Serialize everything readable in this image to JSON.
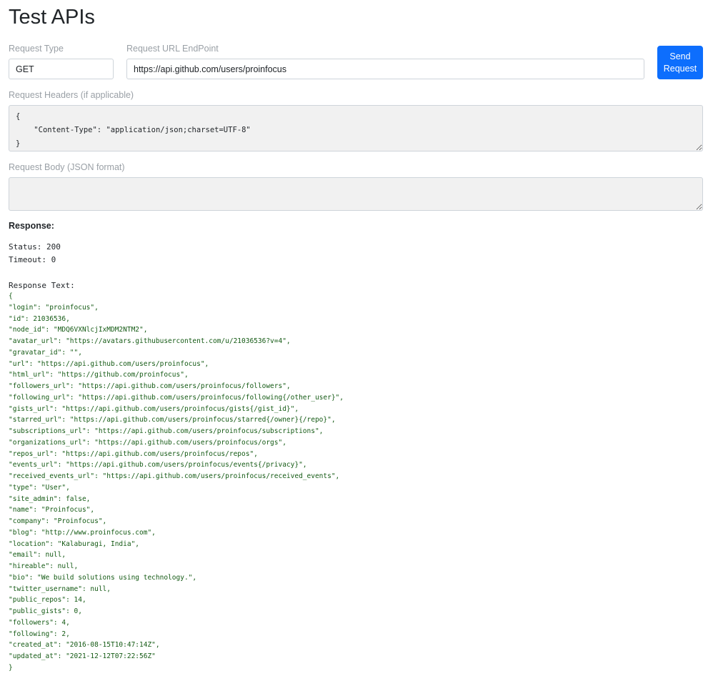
{
  "page": {
    "title": "Test APIs"
  },
  "form": {
    "request_type_label": "Request Type",
    "request_type_value": "GET",
    "url_label": "Request URL EndPoint",
    "url_value": "https://api.github.com/users/proinfocus",
    "send_button_label": "Send Request",
    "headers_label": "Request Headers (if applicable)",
    "headers_value": "{\n    \"Content-Type\": \"application/json;charset=UTF-8\"\n}",
    "body_label": "Request Body (JSON format)",
    "body_value": ""
  },
  "response": {
    "heading": "Response:",
    "status_line": "Status: 200",
    "timeout_line": "Timeout: 0",
    "text_label": "Response Text:",
    "json_text": "{\n\"login\": \"proinfocus\",\n\"id\": 21036536,\n\"node_id\": \"MDQ6VXNlcjIxMDM2NTM2\",\n\"avatar_url\": \"https://avatars.githubusercontent.com/u/21036536?v=4\",\n\"gravatar_id\": \"\",\n\"url\": \"https://api.github.com/users/proinfocus\",\n\"html_url\": \"https://github.com/proinfocus\",\n\"followers_url\": \"https://api.github.com/users/proinfocus/followers\",\n\"following_url\": \"https://api.github.com/users/proinfocus/following{/other_user}\",\n\"gists_url\": \"https://api.github.com/users/proinfocus/gists{/gist_id}\",\n\"starred_url\": \"https://api.github.com/users/proinfocus/starred{/owner}{/repo}\",\n\"subscriptions_url\": \"https://api.github.com/users/proinfocus/subscriptions\",\n\"organizations_url\": \"https://api.github.com/users/proinfocus/orgs\",\n\"repos_url\": \"https://api.github.com/users/proinfocus/repos\",\n\"events_url\": \"https://api.github.com/users/proinfocus/events{/privacy}\",\n\"received_events_url\": \"https://api.github.com/users/proinfocus/received_events\",\n\"type\": \"User\",\n\"site_admin\": false,\n\"name\": \"Proinfocus\",\n\"company\": \"Proinfocus\",\n\"blog\": \"http://www.proinfocus.com\",\n\"location\": \"Kalaburagi, India\",\n\"email\": null,\n\"hireable\": null,\n\"bio\": \"We build solutions using technology.\",\n\"twitter_username\": null,\n\"public_repos\": 14,\n\"public_gists\": 0,\n\"followers\": 4,\n\"following\": 2,\n\"created_at\": \"2016-08-15T10:47:14Z\",\n\"updated_at\": \"2021-12-12T07:22:56Z\"\n}"
  },
  "colors": {
    "accent": "#0d6efd",
    "json_text": "#145a14",
    "label": "#9aa0a6"
  }
}
